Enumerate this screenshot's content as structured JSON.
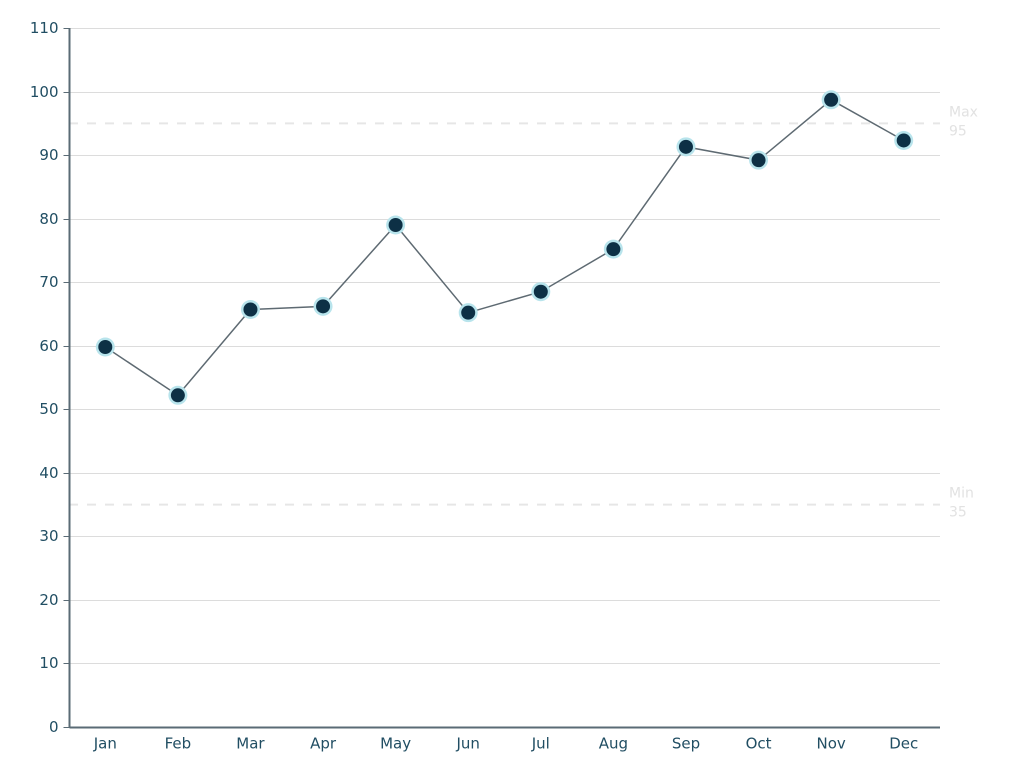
{
  "chart_data": {
    "type": "line",
    "title": "",
    "subtitle": "",
    "xlabel": "",
    "ylabel": "",
    "categories": [
      "Jan",
      "Feb",
      "Mar",
      "Apr",
      "May",
      "Jun",
      "Jul",
      "Aug",
      "Sep",
      "Oct",
      "Nov",
      "Dec"
    ],
    "series": [
      {
        "name": "",
        "values": [
          59.8,
          52.2,
          65.7,
          66.2,
          79.0,
          65.2,
          68.5,
          75.2,
          91.3,
          89.2,
          98.7,
          92.3
        ]
      }
    ],
    "ylim": [
      0,
      110
    ],
    "y_ticks": [
      0,
      10,
      20,
      30,
      40,
      50,
      60,
      70,
      80,
      90,
      100,
      110
    ],
    "y_tick_labels": [
      "0",
      "10",
      "20",
      "30",
      "40",
      "50",
      "60",
      "70",
      "80",
      "90",
      "100",
      "110"
    ],
    "x_tick_labels": [
      "Jan",
      "Feb",
      "Mar",
      "Apr",
      "May",
      "Jun",
      "Jul",
      "Aug",
      "Sep",
      "Oct",
      "Nov",
      "Dec"
    ],
    "grid": true,
    "grid_axis": "y",
    "legend": false,
    "legend_position": "none",
    "reference_lines": [
      {
        "id": "max",
        "label": "Max",
        "value": 95,
        "value_label": "95",
        "style": "dashed"
      },
      {
        "id": "min",
        "label": "Min",
        "value": 35,
        "value_label": "35",
        "style": "dashed"
      }
    ],
    "colors": {
      "marker_core": "#0d3045",
      "marker_halo": "#b8e4ec",
      "line": "#5e6a72",
      "gridline": "#dcdcdc",
      "axis": "#5a6b75",
      "tick_text": "#214e63",
      "reference_line": "#e6e6e6",
      "reference_text": "#e2e2e2",
      "background": "#ffffff"
    }
  }
}
